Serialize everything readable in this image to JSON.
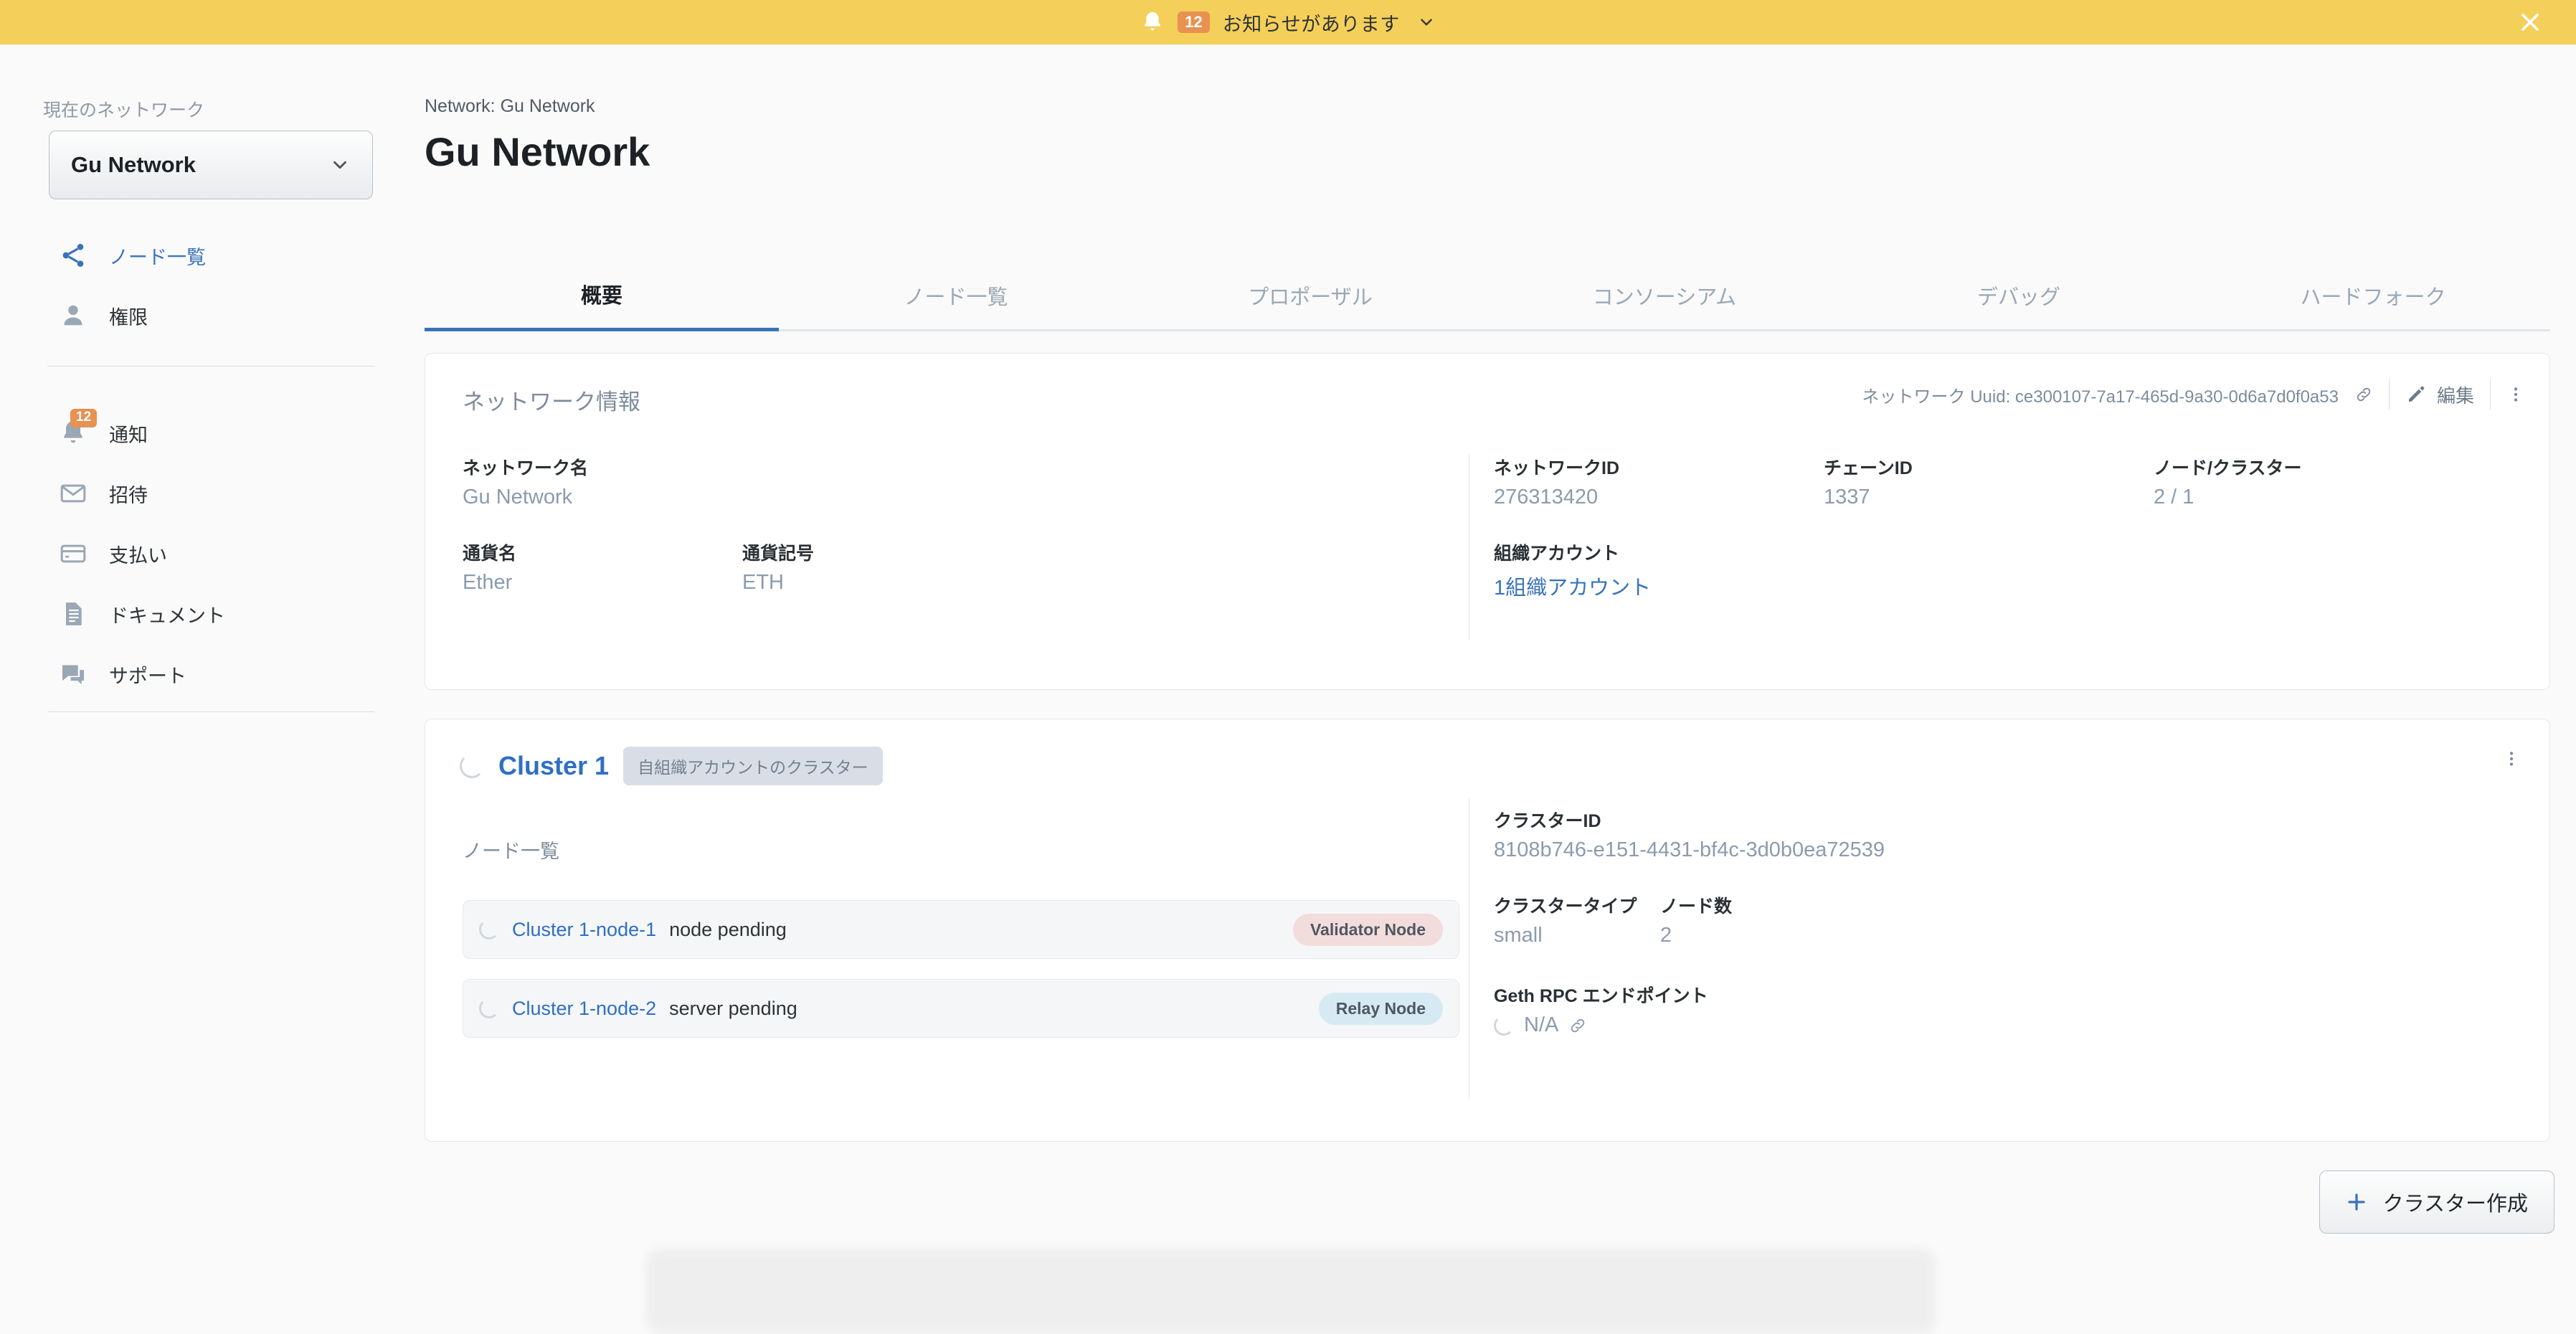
{
  "banner": {
    "icon": "bell-icon",
    "badge": "12",
    "text": "お知らせがあります",
    "caret_icon": "chevron-down-icon",
    "close_icon": "close-icon",
    "bg_color": "#f4cf5a",
    "badge_color": "#e89151"
  },
  "sidebar": {
    "current_network_label": "現在のネットワーク",
    "network_select_value": "Gu Network",
    "primary_items": [
      {
        "label": "ノード一覧",
        "icon": "share-nodes-icon",
        "active": true
      },
      {
        "label": "権限",
        "icon": "person-icon",
        "active": false
      }
    ],
    "secondary_items": [
      {
        "label": "通知",
        "icon": "bell-icon",
        "badge": "12"
      },
      {
        "label": "招待",
        "icon": "envelope-icon",
        "badge": ""
      },
      {
        "label": "支払い",
        "icon": "credit-card-icon",
        "badge": ""
      },
      {
        "label": "ドキュメント",
        "icon": "document-icon",
        "badge": ""
      },
      {
        "label": "サポート",
        "icon": "chat-bubble-icon",
        "badge": ""
      }
    ]
  },
  "main": {
    "breadcrumb": "Network: Gu Network",
    "title": "Gu Network",
    "tabs": [
      {
        "label": "概要",
        "active": true
      },
      {
        "label": "ノード一覧",
        "active": false
      },
      {
        "label": "プロポーザル",
        "active": false
      },
      {
        "label": "コンソーシアム",
        "active": false
      },
      {
        "label": "デバッグ",
        "active": false
      },
      {
        "label": "ハードフォーク",
        "active": false
      }
    ]
  },
  "network_card": {
    "title": "ネットワーク情報",
    "uuid_text": "ネットワーク Uuid: ce300107-7a17-465d-9a30-0d6a7d0f0a53",
    "copy_link_icon": "link-icon",
    "edit_label": "編集",
    "edit_icon": "pencil-icon",
    "more_icon": "kebab-menu-icon",
    "fields": {
      "network_name_label": "ネットワーク名",
      "network_name_value": "Gu Network",
      "currency_name_label": "通貨名",
      "currency_name_value": "Ether",
      "currency_symbol_label": "通貨記号",
      "currency_symbol_value": "ETH",
      "network_id_label": "ネットワークID",
      "network_id_value": "276313420",
      "chain_id_label": "チェーンID",
      "chain_id_value": "1337",
      "nodes_clusters_label": "ノード/クラスター",
      "nodes_clusters_value": "2 / 1",
      "org_account_label": "組織アカウント",
      "org_account_value": "1組織アカウント"
    }
  },
  "cluster_card": {
    "name": "Cluster 1",
    "chip": "自組織アカウントのクラスター",
    "more_icon": "kebab-menu-icon",
    "node_list_title": "ノード一覧",
    "nodes": [
      {
        "name": "Cluster 1-node-1",
        "status": "node pending",
        "badge": "Validator Node",
        "badge_color": "#f3dcdc"
      },
      {
        "name": "Cluster 1-node-2",
        "status": "server pending",
        "badge": "Relay Node",
        "badge_color": "#d6eaf3"
      }
    ],
    "details": {
      "cluster_id_label": "クラスターID",
      "cluster_id_value": "8108b746-e151-4431-bf4c-3d0b0ea72539",
      "cluster_type_label": "クラスタータイプ",
      "cluster_type_value": "small",
      "node_count_label": "ノード数",
      "node_count_value": "2",
      "rpc_label": "Geth RPC エンドポイント",
      "rpc_value": "N/A",
      "rpc_link_icon": "link-icon"
    }
  },
  "footer": {
    "create_cluster_label": "クラスター作成",
    "create_cluster_icon": "plus-icon"
  }
}
